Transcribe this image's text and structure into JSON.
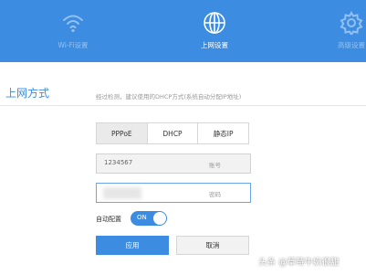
{
  "header": {
    "nav": [
      {
        "label": "Wi-Fi设置",
        "icon": "wifi-icon"
      },
      {
        "label": "上网设置",
        "icon": "globe-icon",
        "active": true
      },
      {
        "label": "高级设置",
        "icon": "gear-icon"
      }
    ]
  },
  "main": {
    "title": "上网方式",
    "hint": "经过检测，建议使用的DHCP方式(系统自动分配IP地址)",
    "tabs": [
      {
        "label": "PPPoE",
        "selected": true
      },
      {
        "label": "DHCP",
        "selected": false
      },
      {
        "label": "静态IP",
        "selected": false
      }
    ],
    "account": {
      "value": "1234567",
      "placeholder": "账号"
    },
    "password": {
      "placeholder": "密码"
    },
    "auto_config": {
      "label": "自动配置",
      "toggle_text": "ON",
      "state": "on"
    },
    "buttons": {
      "apply": "应用",
      "cancel": "取消"
    }
  },
  "watermark": "头条 @草莓牛奶很甜",
  "colors": {
    "accent": "#3c8de2",
    "header_bg": "#3c8de2"
  }
}
